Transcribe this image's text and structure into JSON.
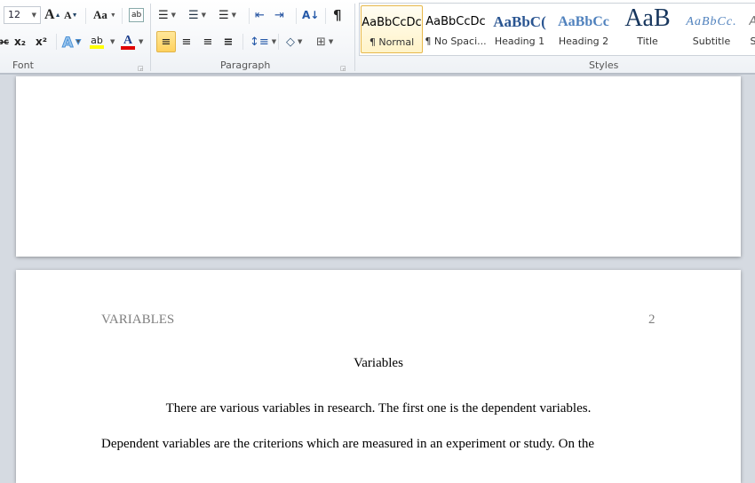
{
  "ribbon": {
    "font": {
      "size": "12",
      "grow": "A",
      "shrink": "A",
      "change_case": "Aa",
      "clear": "ab",
      "strike": "abc",
      "subscript": "x₂",
      "superscript": "x²",
      "effects": "A",
      "highlight": "ab",
      "font_color": "A",
      "label": "Font"
    },
    "paragraph": {
      "bullets": "☰",
      "numbering": "☰",
      "multilevel": "☰",
      "decrease_indent": "⇤",
      "increase_indent": "⇥",
      "sort": "A↓",
      "show_marks": "¶",
      "align_left": "≡",
      "center": "≡",
      "align_right": "≡",
      "justify": "≡",
      "line_spacing": "↕≡",
      "shading": "◇",
      "borders": "⊞",
      "label": "Paragraph"
    },
    "styles": {
      "label": "Styles",
      "items": [
        {
          "preview": "AaBbCcDc",
          "name": "¶ Normal",
          "selected": true
        },
        {
          "preview": "AaBbCcDc",
          "name": "¶ No Spaci..."
        },
        {
          "preview": "AaBbC(",
          "name": "Heading 1"
        },
        {
          "preview": "AaBbCc",
          "name": "Heading 2"
        },
        {
          "preview": "AaB",
          "name": "Title"
        },
        {
          "preview": "AaBbCc.",
          "name": "Subtitle"
        },
        {
          "preview": "A",
          "name": "S"
        }
      ]
    },
    "colors": {
      "highlight": "#ffff00",
      "font_color": "#e00000",
      "accent": "#ffd25e"
    }
  },
  "document": {
    "header_left": "VARIABLES",
    "header_right": "2",
    "title": "Variables",
    "p1": "There are various variables in research. The first one is the dependent variables.",
    "p2": "Dependent variables are the criterions which are measured in an experiment or study. On the"
  }
}
